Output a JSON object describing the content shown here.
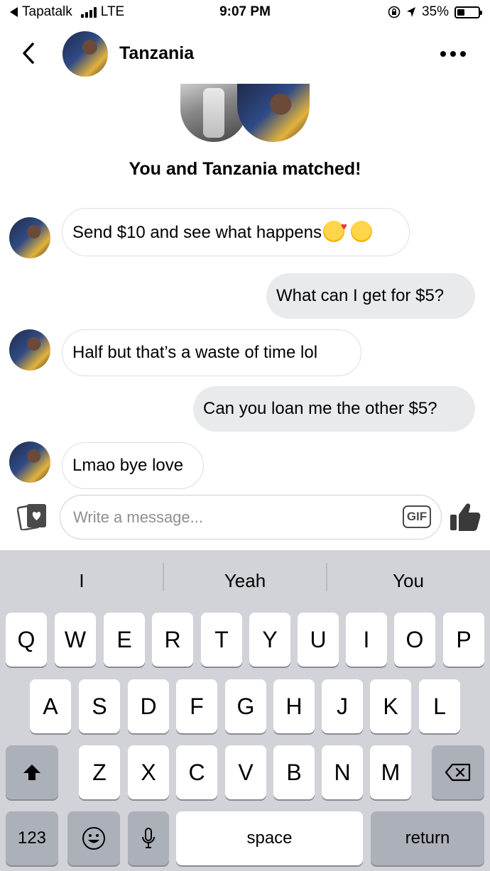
{
  "status_bar": {
    "carrier": "Tapatalk",
    "network": "LTE",
    "time": "9:07 PM",
    "battery": "35%"
  },
  "header": {
    "contact_name": "Tanzania"
  },
  "match": {
    "title": "You and Tanzania matched!"
  },
  "messages": [
    {
      "from": "them",
      "text": "Send $10 and see what happens"
    },
    {
      "from": "me",
      "text": "What can I get for $5?"
    },
    {
      "from": "them",
      "text": "Half but that’s a waste of time lol"
    },
    {
      "from": "me",
      "text": "Can you loan me the other $5?"
    },
    {
      "from": "them",
      "text": "Lmao bye love"
    }
  ],
  "compose": {
    "placeholder": "Write a message...",
    "gif_label": "GIF"
  },
  "keyboard": {
    "suggestions": [
      "I",
      "Yeah",
      "You"
    ],
    "row1": [
      "Q",
      "W",
      "E",
      "R",
      "T",
      "Y",
      "U",
      "I",
      "O",
      "P"
    ],
    "row2": [
      "A",
      "S",
      "D",
      "F",
      "G",
      "H",
      "J",
      "K",
      "L"
    ],
    "row3": [
      "Z",
      "X",
      "C",
      "V",
      "B",
      "N",
      "M"
    ],
    "numbers_label": "123",
    "space_label": "space",
    "return_label": "return"
  }
}
